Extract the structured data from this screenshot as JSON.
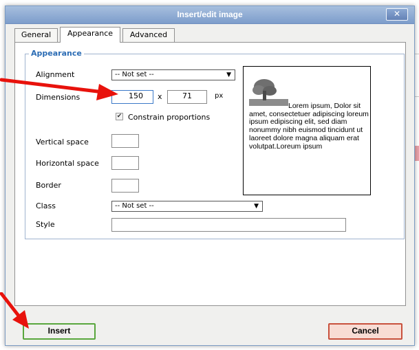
{
  "dialog": {
    "title": "Insert/edit image",
    "close_glyph": "✕"
  },
  "tabs": [
    {
      "label": "General",
      "active": false
    },
    {
      "label": "Appearance",
      "active": true
    },
    {
      "label": "Advanced",
      "active": false
    }
  ],
  "appearance": {
    "legend": "Appearance",
    "alignment": {
      "label": "Alignment",
      "value": "-- Not set --"
    },
    "dimensions": {
      "label": "Dimensions",
      "width": "150",
      "separator": "x",
      "height": "71",
      "unit": "px"
    },
    "constrain": {
      "label": "Constrain proportions",
      "checked": true,
      "check_glyph": "✔"
    },
    "vertical_space": {
      "label": "Vertical space",
      "value": ""
    },
    "horizontal_space": {
      "label": "Horizontal space",
      "value": ""
    },
    "border": {
      "label": "Border",
      "value": ""
    },
    "class": {
      "label": "Class",
      "value": "-- Not set --"
    },
    "style": {
      "label": "Style",
      "value": ""
    },
    "dropdown_arrow": "▼"
  },
  "preview": {
    "image_icon": "tree-thumbnail-icon",
    "text": "Lorem ipsum, Dolor sit amet, consectetuer adipiscing loreum ipsum edipiscing elit, sed diam nonummy nibh euismod tincidunt ut laoreet dolore magna aliquam erat volutpat.Loreum ipsum"
  },
  "buttons": {
    "insert": "Insert",
    "cancel": "Cancel"
  },
  "colors": {
    "titlebar": "#7d9dcb",
    "legend": "#2b6cb4",
    "insert_border": "#58a63c",
    "cancel_border": "#c8503c",
    "annotation_arrow": "#e8120c"
  }
}
